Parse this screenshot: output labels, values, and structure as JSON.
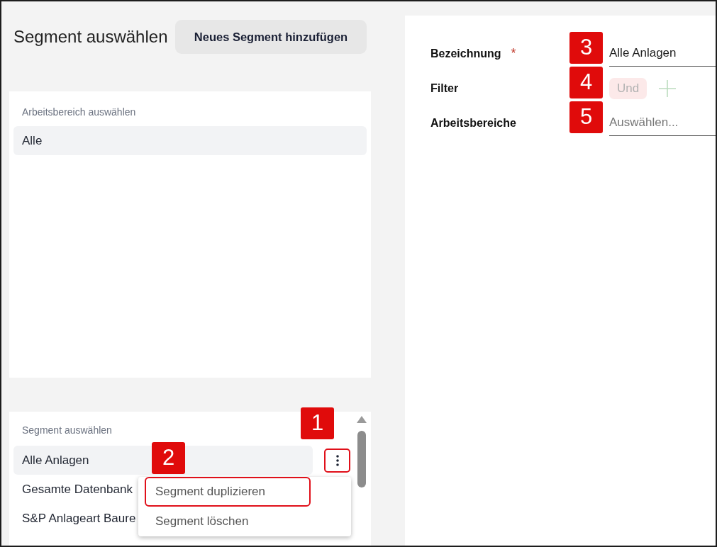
{
  "header": {
    "title": "Segment auswählen",
    "add_button": "Neues Segment hinzufügen"
  },
  "workspace_panel": {
    "label": "Arbeitsbereich auswählen",
    "items": [
      {
        "label": "Alle",
        "selected": true
      }
    ]
  },
  "segment_panel": {
    "label": "Segment auswählen",
    "items": [
      {
        "label": "Alle Anlagen",
        "selected": true
      },
      {
        "label": "Gesamte Datenbank",
        "selected": false
      },
      {
        "label": "S&P Anlageart Baure",
        "selected": false
      }
    ],
    "more_button": {
      "highlighted": true,
      "callout": "1"
    },
    "context_menu": {
      "items": [
        {
          "label": "Segment duplizieren",
          "highlighted": true,
          "callout": "2"
        },
        {
          "label": "Segment löschen",
          "highlighted": false
        }
      ]
    }
  },
  "form": {
    "fields": [
      {
        "kind": "text",
        "label": "Bezeichnung",
        "required_mark": "*",
        "value": "Alle Anlagen",
        "callout": "3"
      },
      {
        "kind": "filter",
        "label": "Filter",
        "chip": "Und",
        "disabled": true,
        "callout": "4"
      },
      {
        "kind": "select",
        "label": "Arbeitsbereiche",
        "placeholder": "Auswählen...",
        "callout": "5"
      }
    ]
  }
}
